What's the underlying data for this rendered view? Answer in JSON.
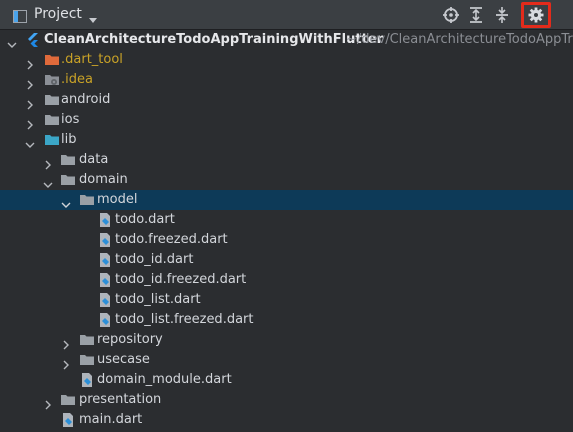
{
  "header": {
    "title": "Project",
    "toolbar": [
      "locate-icon",
      "expand-all-icon",
      "collapse-all-icon",
      "gear-icon"
    ]
  },
  "tree": {
    "root": {
      "name": "CleanArchitectureTodoAppTrainingWithFlutter",
      "path": "~/dev/CleanArchitectureTodoAppTraini"
    },
    "items": [
      {
        "label": ".dart_tool"
      },
      {
        "label": ".idea"
      },
      {
        "label": "android"
      },
      {
        "label": "ios"
      },
      {
        "label": "lib"
      },
      {
        "label": "data"
      },
      {
        "label": "domain"
      },
      {
        "label": "model"
      },
      {
        "label": "todo.dart"
      },
      {
        "label": "todo.freezed.dart"
      },
      {
        "label": "todo_id.dart"
      },
      {
        "label": "todo_id.freezed.dart"
      },
      {
        "label": "todo_list.dart"
      },
      {
        "label": "todo_list.freezed.dart"
      },
      {
        "label": "repository"
      },
      {
        "label": "usecase"
      },
      {
        "label": "domain_module.dart"
      },
      {
        "label": "presentation"
      },
      {
        "label": "main.dart"
      }
    ]
  },
  "colors": {
    "selection": "#0d3a58",
    "excluded_text": "#c9a227",
    "highlight_border": "#e32b1b"
  }
}
